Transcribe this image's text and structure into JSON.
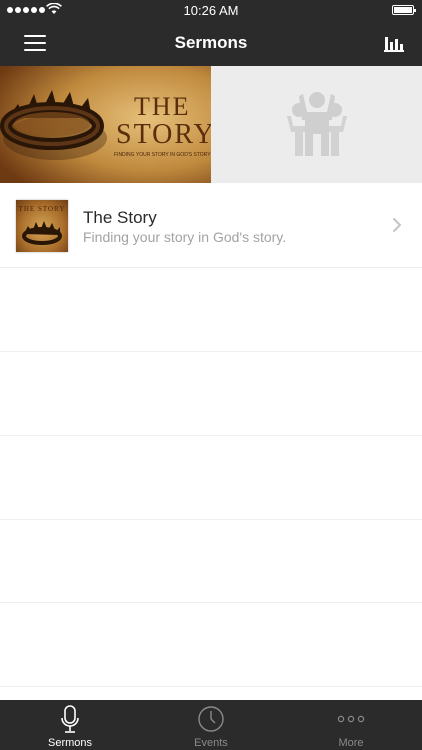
{
  "status": {
    "time": "10:26 AM"
  },
  "nav": {
    "title": "Sermons",
    "menu_icon": "hamburger-menu-icon",
    "stats_icon": "bar-chart-icon"
  },
  "banner": {
    "title_line1": "THE",
    "title_line2": "STORY",
    "tagline": "FINDING YOUR STORY IN GOD'S STORY",
    "placeholder_icon": "people-raising-hands-icon"
  },
  "list": {
    "items": [
      {
        "title": "The Story",
        "subtitle": "Finding your story in God's story.",
        "thumb_text": "THE STORY"
      }
    ]
  },
  "tabs": [
    {
      "label": "Sermons",
      "icon": "microphone-icon",
      "active": true
    },
    {
      "label": "Events",
      "icon": "clock-icon",
      "active": false
    },
    {
      "label": "More",
      "icon": "more-dots-icon",
      "active": false
    }
  ],
  "colors": {
    "bar_background": "#2b2b2b",
    "placeholder_background": "#ececec",
    "subtitle_text": "#a3a3a3",
    "inactive_tab": "#8a8a8a"
  }
}
